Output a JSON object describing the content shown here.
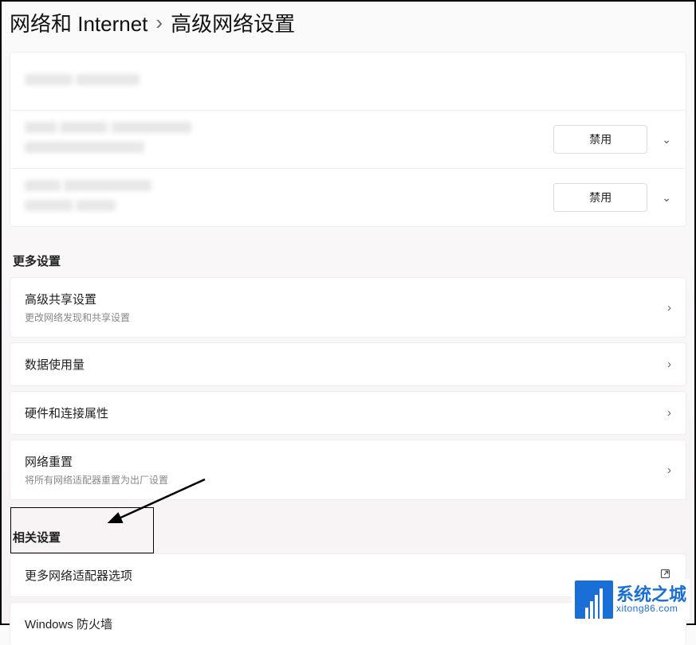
{
  "breadcrumb": {
    "parent": "网络和 Internet",
    "separator": "›",
    "current": "高级网络设置"
  },
  "adapters": {
    "rows": [
      {
        "button": "",
        "show_button": false
      },
      {
        "button": "禁用",
        "show_button": true
      },
      {
        "button": "禁用",
        "show_button": true
      }
    ]
  },
  "sections": {
    "more_settings": "更多设置",
    "related_settings": "相关设置"
  },
  "more_settings_items": [
    {
      "title": "高级共享设置",
      "subtitle": "更改网络发现和共享设置",
      "icon": "chevron-right"
    },
    {
      "title": "数据使用量",
      "subtitle": "",
      "icon": "chevron-right"
    },
    {
      "title": "硬件和连接属性",
      "subtitle": "",
      "icon": "chevron-right"
    },
    {
      "title": "网络重置",
      "subtitle": "将所有网络适配器重置为出厂设置",
      "icon": "chevron-right"
    }
  ],
  "related_settings_items": [
    {
      "title": "更多网络适配器选项",
      "subtitle": "",
      "icon": "external-link"
    },
    {
      "title": "Windows 防火墙",
      "subtitle": "",
      "icon": ""
    }
  ],
  "watermark": {
    "title": "系统之城",
    "sub": "xitong86.com"
  }
}
